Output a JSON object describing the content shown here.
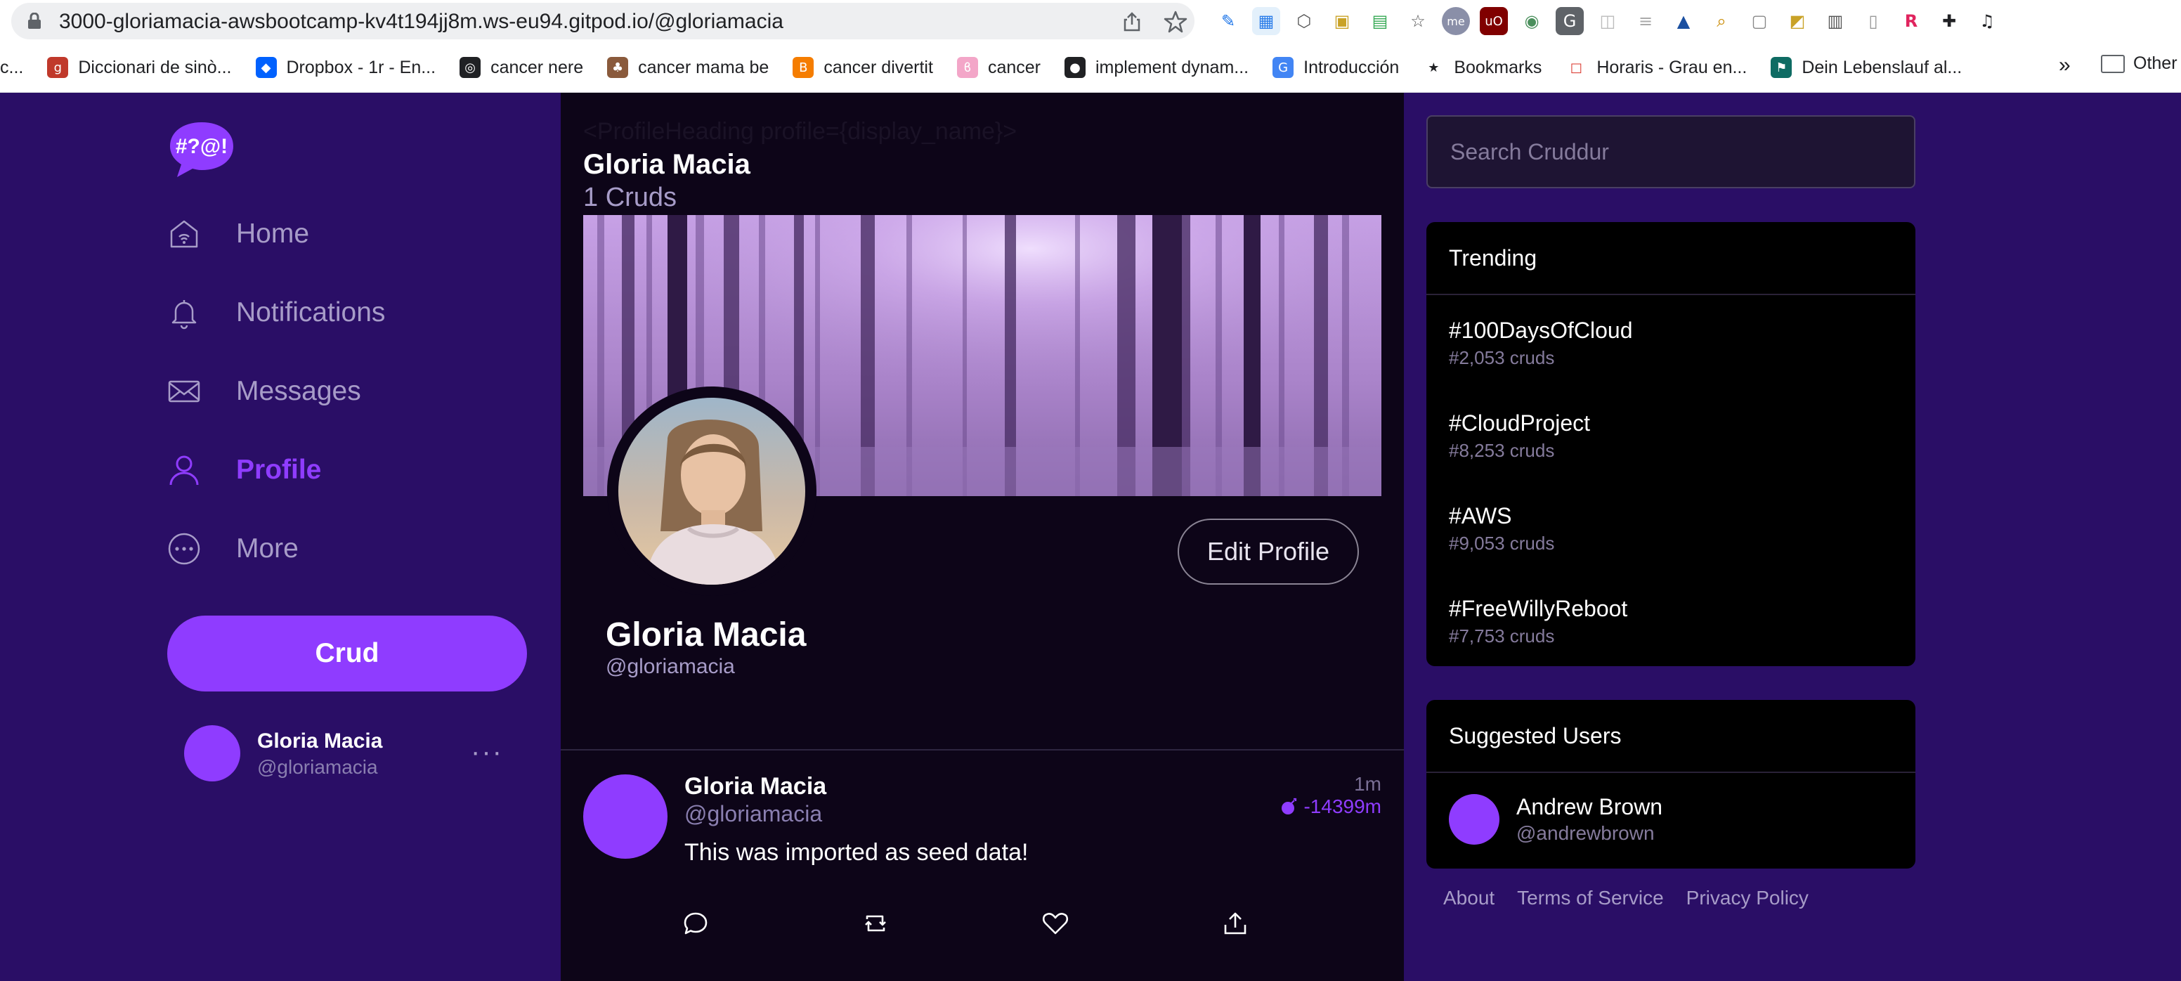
{
  "browser": {
    "url": "3000-gloriamacia-awsbootcamp-kv4t194jj8m.ws-eu94.gitpod.io/@gloriamacia",
    "extensions": [
      "pen-icon",
      "window-icon",
      "hexagon-icon",
      "image-icon",
      "printer-icon",
      "star-icon",
      "me-icon",
      "ublock-icon",
      "globe-icon",
      "g-icon",
      "puzzle-light-icon",
      "text-icon",
      "grad-cap-icon",
      "search-doc-icon",
      "doc-icon",
      "bell-doc-icon",
      "grid-icon",
      "page-icon",
      "r-icon",
      "puzzle-icon",
      "media-icon"
    ],
    "bookmarks": [
      {
        "label": "c...",
        "icon": "none"
      },
      {
        "label": "Diccionari de sinò...",
        "icon": "gencat-icon"
      },
      {
        "label": "Dropbox - 1r - En...",
        "icon": "dropbox-icon"
      },
      {
        "label": "cancer nere",
        "icon": "globe-icon"
      },
      {
        "label": "cancer mama be",
        "icon": "mushroom-icon"
      },
      {
        "label": "cancer divertit",
        "icon": "blogger-icon"
      },
      {
        "label": "cancer",
        "icon": "ribbon-icon"
      },
      {
        "label": "implement dynam...",
        "icon": "github-icon"
      },
      {
        "label": "Introducción",
        "icon": "google-icon"
      },
      {
        "label": "Bookmarks",
        "icon": "star-icon"
      },
      {
        "label": "Horaris - Grau en...",
        "icon": "square-icon"
      },
      {
        "label": "Dein Lebenslauf al...",
        "icon": "bookmark-icon"
      }
    ],
    "more_label": "»",
    "other_label": "Other"
  },
  "nav": {
    "items": [
      {
        "label": "Home",
        "icon": "home-icon",
        "active": false
      },
      {
        "label": "Notifications",
        "icon": "bell-icon",
        "active": false
      },
      {
        "label": "Messages",
        "icon": "envelope-icon",
        "active": false
      },
      {
        "label": "Profile",
        "icon": "user-icon",
        "active": true
      },
      {
        "label": "More",
        "icon": "more-circle-icon",
        "active": false
      }
    ],
    "crud_label": "Crud",
    "logo_text": "#?@!",
    "me": {
      "name": "Gloria Macia",
      "handle": "@gloriamacia",
      "more": "···"
    }
  },
  "profile": {
    "raw_header": "<ProfileHeading profile={display_name}>",
    "display_name": "Gloria Macia",
    "cruds_count": "1 Cruds",
    "handle": "@gloriamacia",
    "edit_label": "Edit Profile"
  },
  "post": {
    "name": "Gloria Macia",
    "handle": "@gloriamacia",
    "time": "1m",
    "expires": "-14399m",
    "text": "This was imported as seed data!",
    "actions": [
      "reply-icon",
      "repost-icon",
      "like-icon",
      "share-icon"
    ]
  },
  "search": {
    "placeholder": "Search Cruddur"
  },
  "trending": {
    "title": "Trending",
    "items": [
      {
        "tag": "#100DaysOfCloud",
        "count": "#2,053 cruds"
      },
      {
        "tag": "#CloudProject",
        "count": "#8,253 cruds"
      },
      {
        "tag": "#AWS",
        "count": "#9,053 cruds"
      },
      {
        "tag": "#FreeWillyReboot",
        "count": "#7,753 cruds"
      }
    ]
  },
  "suggested": {
    "title": "Suggested Users",
    "users": [
      {
        "name": "Andrew Brown",
        "handle": "@andrewbrown"
      }
    ]
  },
  "footer": {
    "links": [
      "About",
      "Terms of Service",
      "Privacy Policy"
    ]
  },
  "colors": {
    "accent": "#8f3cff",
    "sidebar_bg": "#2a0e66",
    "feed_bg": "#0d0518",
    "panel_bg": "#000000"
  }
}
